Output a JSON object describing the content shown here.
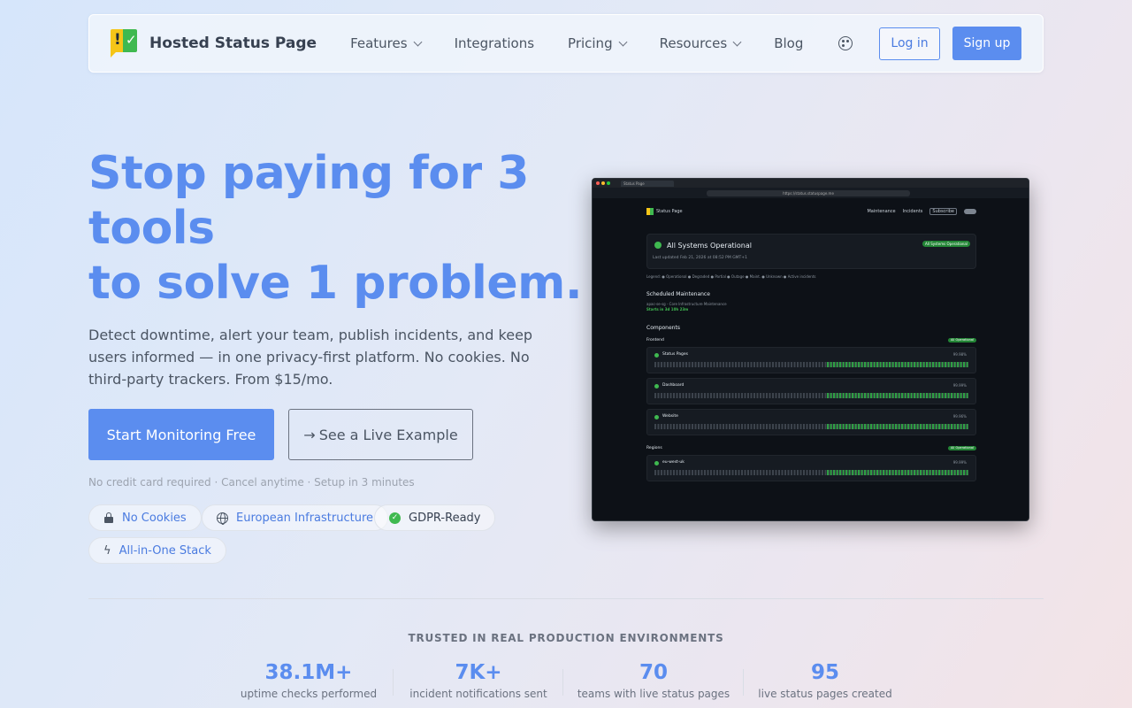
{
  "nav": {
    "brand": "Hosted Status Page",
    "items": [
      {
        "label": "Features",
        "dropdown": true
      },
      {
        "label": "Integrations",
        "dropdown": false
      },
      {
        "label": "Pricing",
        "dropdown": true
      },
      {
        "label": "Resources",
        "dropdown": true
      },
      {
        "label": "Blog",
        "dropdown": false
      }
    ],
    "login": "Log in",
    "signup": "Sign up"
  },
  "hero": {
    "headline": [
      "Stop paying for 3",
      "tools",
      "to solve 1 problem."
    ],
    "subtitle": "Detect downtime, alert your team, publish incidents, and keep users informed — in one privacy-first platform. No cookies. No third-party trackers. From $15/mo.",
    "cta_primary": "Start Monitoring Free",
    "cta_secondary_arrow": "→",
    "cta_secondary": "See a Live Example",
    "fine_print": "No credit card required · Cancel anytime · Setup in 3 minutes",
    "badges": [
      {
        "label": "No Cookies",
        "icon": "lock-icon"
      },
      {
        "label": "European Infrastructure",
        "icon": "globe-icon"
      },
      {
        "label": "GDPR-Ready",
        "icon": "check-circle-icon"
      },
      {
        "label": "All-in-One Stack",
        "icon": "bolt-icon"
      }
    ]
  },
  "preview": {
    "tab": "Status Page",
    "url": "https://status.statuspage.me",
    "brand": "Status Page",
    "nav": [
      "Maintenance",
      "Incidents",
      "Subscribe"
    ],
    "status_title": "All Systems Operational",
    "status_badge": "All Systems Operational",
    "last_updated": "Last updated Feb 21, 2026 at 08:52 PM GMT+1",
    "legend": "Legend:  ● Operational  ● Degraded  ● Partial  ● Outage  ● Maint.  ● Unknown  ● Active incidents",
    "maintenance_heading": "Scheduled Maintenance",
    "maintenance_title": "apac-se-sg - Core Infrastructure Maintenance",
    "maintenance_countdown": "Starts in 3d 10h 23m",
    "components_heading": "Components",
    "groups": [
      {
        "name": "Frontend",
        "badge": "All Operational"
      },
      {
        "name": "Regions",
        "badge": "All Operational"
      }
    ],
    "rows": [
      {
        "name": "Status Pages",
        "pct": "99.98%"
      },
      {
        "name": "Dashboard",
        "pct": "99.99%"
      },
      {
        "name": "Website",
        "pct": "99.96%"
      },
      {
        "name": "eu-west-uk",
        "pct": "99.99%"
      }
    ]
  },
  "stats": {
    "heading": "TRUSTED IN REAL PRODUCTION ENVIRONMENTS",
    "items": [
      {
        "value": "38.1M+",
        "label": "uptime checks performed"
      },
      {
        "value": "7K+",
        "label": "incident notifications sent"
      },
      {
        "value": "70",
        "label": "teams with live status pages"
      },
      {
        "value": "95",
        "label": "live status pages created"
      }
    ]
  }
}
